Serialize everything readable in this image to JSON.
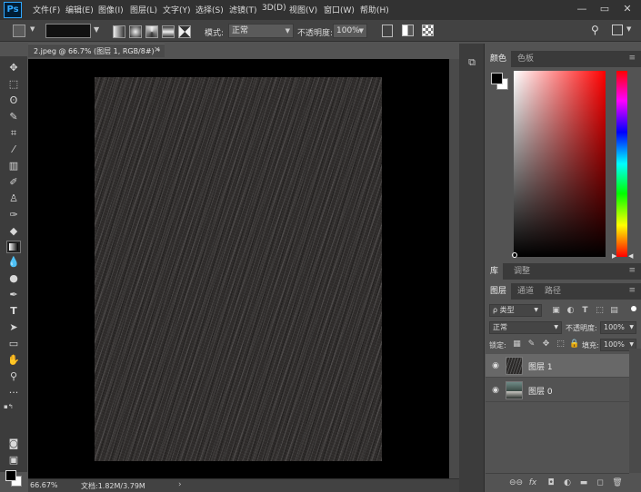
{
  "app": {
    "logo": "Ps"
  },
  "menu": [
    "文件(F)",
    "编辑(E)",
    "图像(I)",
    "图层(L)",
    "文字(Y)",
    "选择(S)",
    "滤镜(T)",
    "3D(D)",
    "视图(V)",
    "窗口(W)",
    "帮助(H)"
  ],
  "window_controls": {
    "minimize": "—",
    "restore": "▭",
    "close": "✕"
  },
  "options": {
    "mode_label": "模式:",
    "mode_value": "正常",
    "opacity_label": "不透明度:",
    "opacity_value": "100%"
  },
  "document": {
    "tab_title": "2.jpeg @ 66.7% (图层 1, RGB/8#) *",
    "close": "×",
    "zoom": "66.67%",
    "doc_info": "文档:1.82M/3.79M",
    "status_arrow": "›"
  },
  "color_panel": {
    "tabs": [
      "颜色",
      "色板"
    ],
    "colors": {
      "foreground": "#000000",
      "background": "#ffffff"
    }
  },
  "library_panel": {
    "tabs": [
      "库",
      "调整"
    ]
  },
  "layers_panel": {
    "tabs": [
      "图层",
      "通道",
      "路径"
    ],
    "filter_kind": "ρ 类型",
    "blend_mode": "正常",
    "opacity_label": "不透明度:",
    "opacity_value": "100%",
    "lock_label": "锁定:",
    "fill_label": "填充:",
    "fill_value": "100%",
    "layers": [
      {
        "name": "图层 1",
        "selected": true
      },
      {
        "name": "图层 0",
        "selected": false
      }
    ],
    "footer_icons": [
      "link-icon",
      "fx-icon",
      "mask-icon",
      "adjustment-icon",
      "group-icon",
      "new-layer-icon",
      "trash-icon"
    ],
    "footer_glyphs": [
      "⊖⊖",
      "fx",
      "◘",
      "◐",
      "▬",
      "◻",
      "🗑"
    ]
  }
}
